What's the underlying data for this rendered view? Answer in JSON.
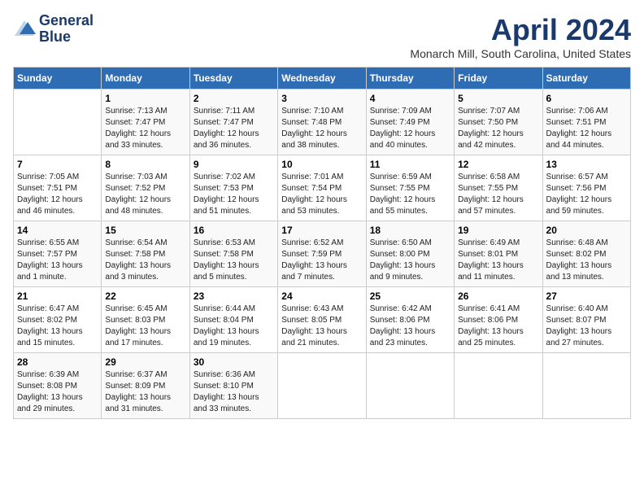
{
  "header": {
    "logo_line1": "General",
    "logo_line2": "Blue",
    "month": "April 2024",
    "location": "Monarch Mill, South Carolina, United States"
  },
  "days_of_week": [
    "Sunday",
    "Monday",
    "Tuesday",
    "Wednesday",
    "Thursday",
    "Friday",
    "Saturday"
  ],
  "weeks": [
    [
      {
        "num": "",
        "empty": true
      },
      {
        "num": "1",
        "sunrise": "Sunrise: 7:13 AM",
        "sunset": "Sunset: 7:47 PM",
        "daylight": "Daylight: 12 hours and 33 minutes."
      },
      {
        "num": "2",
        "sunrise": "Sunrise: 7:11 AM",
        "sunset": "Sunset: 7:47 PM",
        "daylight": "Daylight: 12 hours and 36 minutes."
      },
      {
        "num": "3",
        "sunrise": "Sunrise: 7:10 AM",
        "sunset": "Sunset: 7:48 PM",
        "daylight": "Daylight: 12 hours and 38 minutes."
      },
      {
        "num": "4",
        "sunrise": "Sunrise: 7:09 AM",
        "sunset": "Sunset: 7:49 PM",
        "daylight": "Daylight: 12 hours and 40 minutes."
      },
      {
        "num": "5",
        "sunrise": "Sunrise: 7:07 AM",
        "sunset": "Sunset: 7:50 PM",
        "daylight": "Daylight: 12 hours and 42 minutes."
      },
      {
        "num": "6",
        "sunrise": "Sunrise: 7:06 AM",
        "sunset": "Sunset: 7:51 PM",
        "daylight": "Daylight: 12 hours and 44 minutes."
      }
    ],
    [
      {
        "num": "7",
        "sunrise": "Sunrise: 7:05 AM",
        "sunset": "Sunset: 7:51 PM",
        "daylight": "Daylight: 12 hours and 46 minutes."
      },
      {
        "num": "8",
        "sunrise": "Sunrise: 7:03 AM",
        "sunset": "Sunset: 7:52 PM",
        "daylight": "Daylight: 12 hours and 48 minutes."
      },
      {
        "num": "9",
        "sunrise": "Sunrise: 7:02 AM",
        "sunset": "Sunset: 7:53 PM",
        "daylight": "Daylight: 12 hours and 51 minutes."
      },
      {
        "num": "10",
        "sunrise": "Sunrise: 7:01 AM",
        "sunset": "Sunset: 7:54 PM",
        "daylight": "Daylight: 12 hours and 53 minutes."
      },
      {
        "num": "11",
        "sunrise": "Sunrise: 6:59 AM",
        "sunset": "Sunset: 7:55 PM",
        "daylight": "Daylight: 12 hours and 55 minutes."
      },
      {
        "num": "12",
        "sunrise": "Sunrise: 6:58 AM",
        "sunset": "Sunset: 7:55 PM",
        "daylight": "Daylight: 12 hours and 57 minutes."
      },
      {
        "num": "13",
        "sunrise": "Sunrise: 6:57 AM",
        "sunset": "Sunset: 7:56 PM",
        "daylight": "Daylight: 12 hours and 59 minutes."
      }
    ],
    [
      {
        "num": "14",
        "sunrise": "Sunrise: 6:55 AM",
        "sunset": "Sunset: 7:57 PM",
        "daylight": "Daylight: 13 hours and 1 minute."
      },
      {
        "num": "15",
        "sunrise": "Sunrise: 6:54 AM",
        "sunset": "Sunset: 7:58 PM",
        "daylight": "Daylight: 13 hours and 3 minutes."
      },
      {
        "num": "16",
        "sunrise": "Sunrise: 6:53 AM",
        "sunset": "Sunset: 7:58 PM",
        "daylight": "Daylight: 13 hours and 5 minutes."
      },
      {
        "num": "17",
        "sunrise": "Sunrise: 6:52 AM",
        "sunset": "Sunset: 7:59 PM",
        "daylight": "Daylight: 13 hours and 7 minutes."
      },
      {
        "num": "18",
        "sunrise": "Sunrise: 6:50 AM",
        "sunset": "Sunset: 8:00 PM",
        "daylight": "Daylight: 13 hours and 9 minutes."
      },
      {
        "num": "19",
        "sunrise": "Sunrise: 6:49 AM",
        "sunset": "Sunset: 8:01 PM",
        "daylight": "Daylight: 13 hours and 11 minutes."
      },
      {
        "num": "20",
        "sunrise": "Sunrise: 6:48 AM",
        "sunset": "Sunset: 8:02 PM",
        "daylight": "Daylight: 13 hours and 13 minutes."
      }
    ],
    [
      {
        "num": "21",
        "sunrise": "Sunrise: 6:47 AM",
        "sunset": "Sunset: 8:02 PM",
        "daylight": "Daylight: 13 hours and 15 minutes."
      },
      {
        "num": "22",
        "sunrise": "Sunrise: 6:45 AM",
        "sunset": "Sunset: 8:03 PM",
        "daylight": "Daylight: 13 hours and 17 minutes."
      },
      {
        "num": "23",
        "sunrise": "Sunrise: 6:44 AM",
        "sunset": "Sunset: 8:04 PM",
        "daylight": "Daylight: 13 hours and 19 minutes."
      },
      {
        "num": "24",
        "sunrise": "Sunrise: 6:43 AM",
        "sunset": "Sunset: 8:05 PM",
        "daylight": "Daylight: 13 hours and 21 minutes."
      },
      {
        "num": "25",
        "sunrise": "Sunrise: 6:42 AM",
        "sunset": "Sunset: 8:06 PM",
        "daylight": "Daylight: 13 hours and 23 minutes."
      },
      {
        "num": "26",
        "sunrise": "Sunrise: 6:41 AM",
        "sunset": "Sunset: 8:06 PM",
        "daylight": "Daylight: 13 hours and 25 minutes."
      },
      {
        "num": "27",
        "sunrise": "Sunrise: 6:40 AM",
        "sunset": "Sunset: 8:07 PM",
        "daylight": "Daylight: 13 hours and 27 minutes."
      }
    ],
    [
      {
        "num": "28",
        "sunrise": "Sunrise: 6:39 AM",
        "sunset": "Sunset: 8:08 PM",
        "daylight": "Daylight: 13 hours and 29 minutes."
      },
      {
        "num": "29",
        "sunrise": "Sunrise: 6:37 AM",
        "sunset": "Sunset: 8:09 PM",
        "daylight": "Daylight: 13 hours and 31 minutes."
      },
      {
        "num": "30",
        "sunrise": "Sunrise: 6:36 AM",
        "sunset": "Sunset: 8:10 PM",
        "daylight": "Daylight: 13 hours and 33 minutes."
      },
      {
        "num": "",
        "empty": true
      },
      {
        "num": "",
        "empty": true
      },
      {
        "num": "",
        "empty": true
      },
      {
        "num": "",
        "empty": true
      }
    ]
  ]
}
